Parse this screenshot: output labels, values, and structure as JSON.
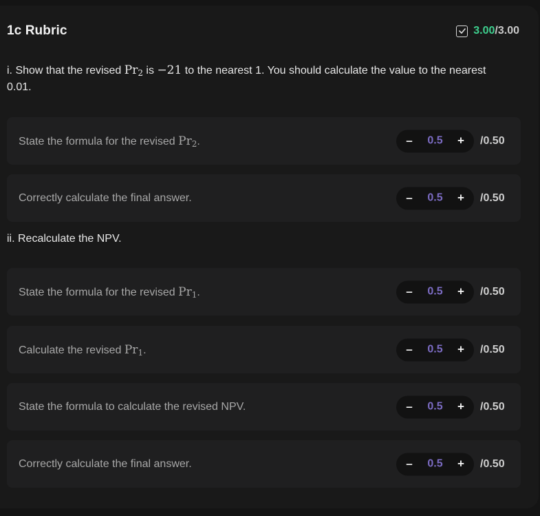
{
  "header": {
    "title": "1c Rubric",
    "score_earned": "3.00",
    "score_total": "/3.00"
  },
  "questions": [
    {
      "text_pre": "i. Show that the revised ",
      "math_var": "Pr",
      "math_sub": "2",
      "text_mid": " is ",
      "math_value": "−21",
      "text_post": " to the nearest 1. You should calculate the value to the nearest 0.01."
    },
    {
      "text": "ii. Recalculate the NPV."
    }
  ],
  "criteria": [
    {
      "label": "State the formula for the revised ",
      "math_var": "Pr",
      "math_sub": "2",
      "suffix": ".",
      "value": "0.5",
      "max": "/0.50"
    },
    {
      "label": "Correctly calculate the final answer.",
      "value": "0.5",
      "max": "/0.50"
    },
    {
      "label": "State the formula for the revised ",
      "math_var": "Pr",
      "math_sub": "1",
      "suffix": ".",
      "value": "0.5",
      "max": "/0.50"
    },
    {
      "label": "Calculate the revised ",
      "math_var": "Pr",
      "math_sub": "1",
      "suffix": ".",
      "value": "0.5",
      "max": "/0.50"
    },
    {
      "label": "State the formula to calculate the revised NPV.",
      "value": "0.5",
      "max": "/0.50"
    },
    {
      "label": "Correctly calculate the final answer.",
      "value": "0.5",
      "max": "/0.50"
    }
  ],
  "stepper": {
    "minus": "–",
    "plus": "+"
  },
  "colors": {
    "accent_green": "#3ecf8e",
    "accent_purple": "#7c6cc4"
  },
  "icons": {
    "score": "checkbox-checked-icon"
  }
}
